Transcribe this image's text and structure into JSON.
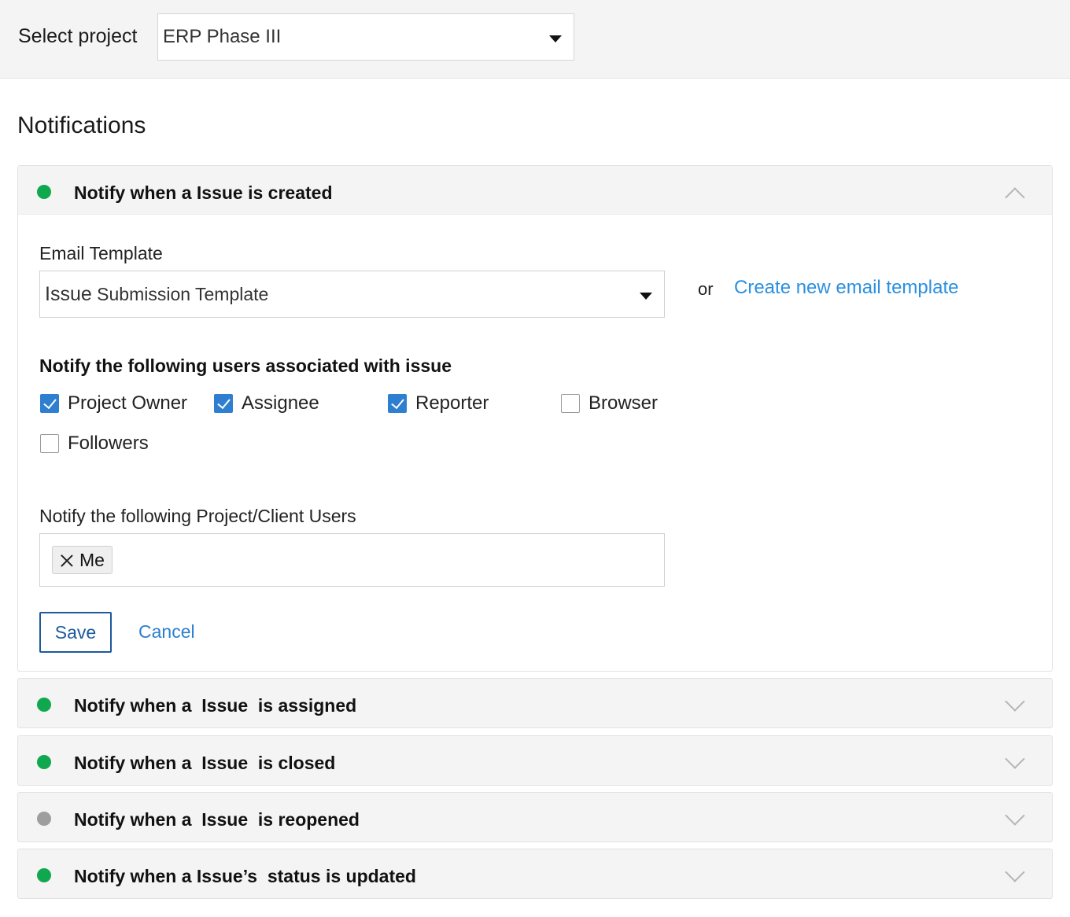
{
  "header": {
    "select_project_label": "Select project",
    "project_value": "ERP Phase III"
  },
  "section_title": "Notifications",
  "panels": [
    {
      "title": "Notify when a Issue is created",
      "status_color": "#10a84e",
      "expanded": true,
      "email_template_label": "Email Template",
      "email_template_value_prefix": "Issue",
      "email_template_value_rest": "Submission Template",
      "or_text": "or",
      "create_template_link": "Create new email template",
      "users_heading": "Notify the following users associated with issue",
      "user_checks": [
        {
          "label": "Project Owner",
          "checked": true
        },
        {
          "label": "Assignee",
          "checked": true
        },
        {
          "label": "Reporter",
          "checked": true
        },
        {
          "label": "Browser",
          "checked": false
        },
        {
          "label": "Followers",
          "checked": false
        }
      ],
      "client_users_label": "Notify the following Project/Client Users",
      "client_users": [
        "Me"
      ],
      "save_label": "Save",
      "cancel_label": "Cancel"
    },
    {
      "title": "Notify when a  Issue  is assigned",
      "status_color": "#10a84e",
      "expanded": false
    },
    {
      "title": "Notify when a  Issue  is closed",
      "status_color": "#10a84e",
      "expanded": false
    },
    {
      "title": "Notify when a  Issue  is reopened",
      "status_color": "#9e9e9e",
      "expanded": false
    },
    {
      "title": "Notify when a Issue’s  status is updated",
      "status_color": "#10a84e",
      "expanded": false
    }
  ]
}
